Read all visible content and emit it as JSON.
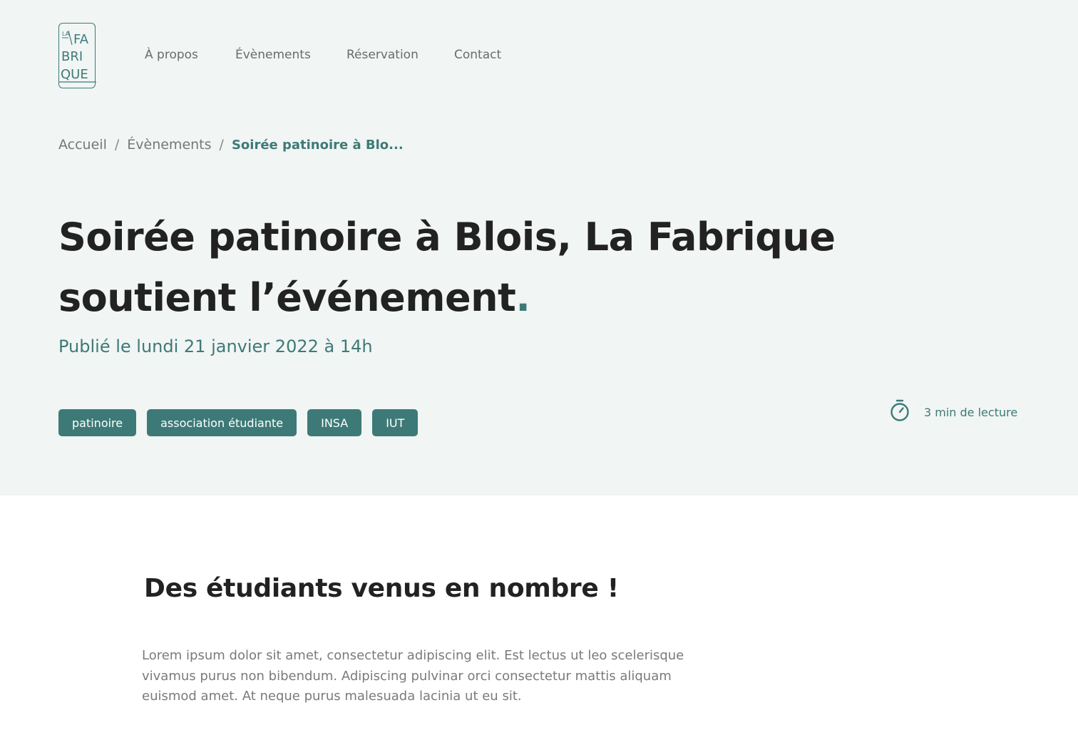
{
  "brand": {
    "logo_lines": [
      "LA",
      "FA",
      "BRI",
      "QUE"
    ],
    "accent_color": "#3d7a77",
    "hero_background": "#f1f5f4"
  },
  "nav": {
    "items": [
      {
        "label": "À propos"
      },
      {
        "label": "Évènements"
      },
      {
        "label": "Réservation"
      },
      {
        "label": "Contact"
      }
    ]
  },
  "breadcrumb": {
    "items": [
      "Accueil",
      "Évènements"
    ],
    "separator": "/",
    "current": "Soirée patinoire à Blo..."
  },
  "article": {
    "title": "Soirée patinoire à Blois, La Fabrique soutient l’événement",
    "title_punctuation": ".",
    "published": "Publié le lundi 21 janvier 2022 à 14h",
    "tags": [
      "patinoire",
      "association étudiante",
      "INSA",
      "IUT"
    ],
    "reading_time": "3 min de lecture",
    "reading_icon": "stopwatch-icon",
    "section_title": "Des étudiants venus en nombre !",
    "paragraph": "Lorem ipsum dolor sit amet, consectetur adipiscing elit. Est lectus ut leo scelerisque vivamus purus non bibendum. Adipiscing pulvinar orci consectetur mattis aliquam euismod amet. At neque purus malesuada lacinia ut eu sit."
  }
}
